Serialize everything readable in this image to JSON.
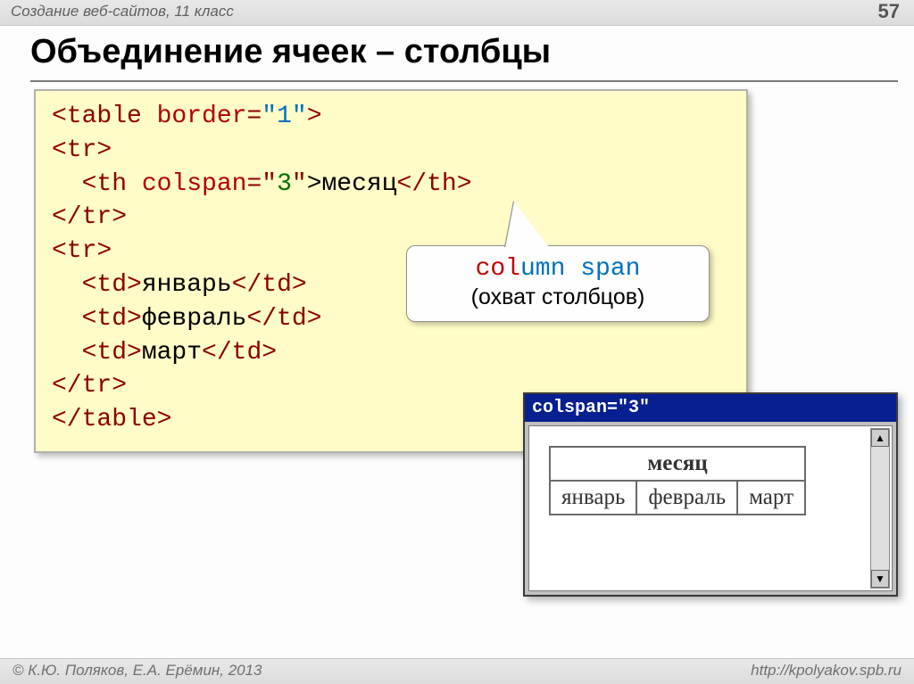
{
  "header": {
    "course": "Создание веб-сайтов, 11 класс",
    "page": "57"
  },
  "title": "Объединение ячеек – столбцы",
  "code": {
    "l1a": "<table ",
    "l1b": "border",
    "l1c": "=",
    "l1d": "\"1\"",
    "l1e": ">",
    "l2": "<tr>",
    "l3a": "  <th ",
    "l3b": "colspan",
    "l3c": "=\"",
    "l3d": "3",
    "l3e": "\"",
    "l3f": ">месяц",
    "l3g": "</th>",
    "l4": "</tr>",
    "l5": "<tr>",
    "l6a": "  <td>",
    "l6b": "январь",
    "l6c": "</td>",
    "l7a": "  <td>",
    "l7b": "февраль",
    "l7c": "</td>",
    "l8a": "  <td>",
    "l8b": "март",
    "l8c": "</td>",
    "l9": "</tr>",
    "l10": "</table>"
  },
  "callout": {
    "em": "col",
    "rest": "umn span",
    "sub": "(охват столбцов)"
  },
  "browser": {
    "title": "colspan=\"3\"",
    "th": "месяц",
    "c1": "январь",
    "c2": "февраль",
    "c3": "март",
    "scroll_up": "▲",
    "scroll_down": "▼"
  },
  "footer": {
    "left": "© К.Ю. Поляков, Е.А. Ерёмин, 2013",
    "right": "http://kpolyakov.spb.ru"
  }
}
